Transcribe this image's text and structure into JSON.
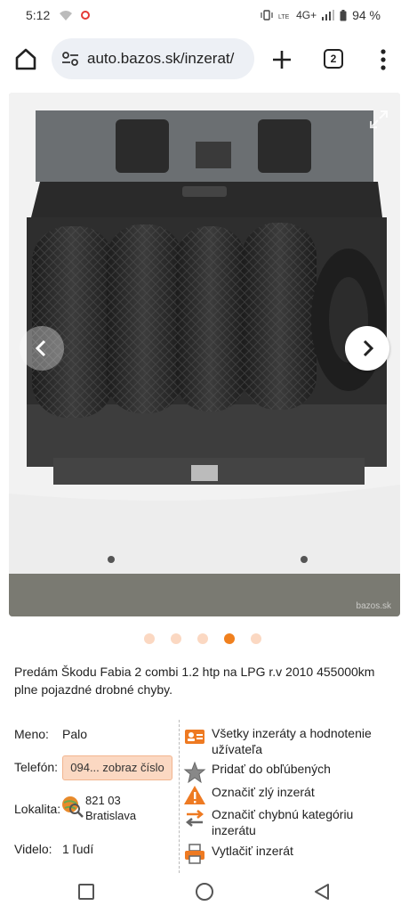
{
  "status": {
    "time": "5:12",
    "network": "4G+",
    "battery": "94 %"
  },
  "browser": {
    "url": "auto.bazos.sk/inzerat/",
    "tab_count": "2"
  },
  "gallery": {
    "watermark": "bazos.sk",
    "dots_total": 5,
    "active_dot": 4
  },
  "listing": {
    "description": "Predám Škodu Fabia 2 combi 1.2 htp na LPG r.v 2010 455000km plne pojazdné drobné chyby."
  },
  "details": {
    "name_label": "Meno:",
    "name_value": "Palo",
    "phone_label": "Telefón:",
    "phone_value": "094... zobraz číslo",
    "location_label": "Lokalita:",
    "location_zip": "821 03",
    "location_city": "Bratislava",
    "views_label": "Videlo:",
    "views_value": "1 ľudí"
  },
  "actions": [
    {
      "label": "Všetky inzeráty a hodnotenie užívateľa",
      "icon": "user-card-icon"
    },
    {
      "label": "Pridať do obľúbených",
      "icon": "star-icon"
    },
    {
      "label": "Označiť zlý inzerát",
      "icon": "warning-icon"
    },
    {
      "label": "Označiť chybnú kategóriu inzerátu",
      "icon": "swap-arrows-icon"
    },
    {
      "label": "Vytlačiť inzerát",
      "icon": "printer-icon"
    }
  ],
  "colors": {
    "accent": "#f0801e",
    "accent_light": "#fbd8c2"
  }
}
